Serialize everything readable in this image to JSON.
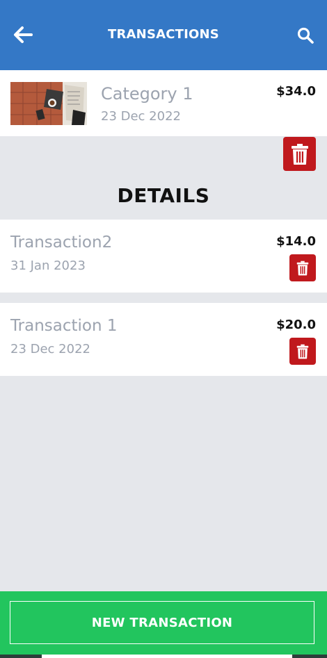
{
  "header": {
    "title": "TRANSACTIONS",
    "back_icon": "arrow-left-icon",
    "search_icon": "search-icon",
    "background": "#3478c6"
  },
  "category": {
    "name": "Category 1",
    "date": "23 Dec 2022",
    "amount": "$34.0"
  },
  "details": {
    "heading": "DETAILS"
  },
  "transactions": [
    {
      "name": "Transaction2",
      "date": "31 Jan 2023",
      "amount": "$14.0"
    },
    {
      "name": "Transaction 1",
      "date": "23 Dec 2022",
      "amount": "$20.0"
    }
  ],
  "footer": {
    "new_label": "NEW TRANSACTION",
    "background": "#22c55e"
  },
  "colors": {
    "delete": "#c0191d",
    "muted_text": "#9ca3af",
    "page_bg": "#e5e7eb"
  }
}
